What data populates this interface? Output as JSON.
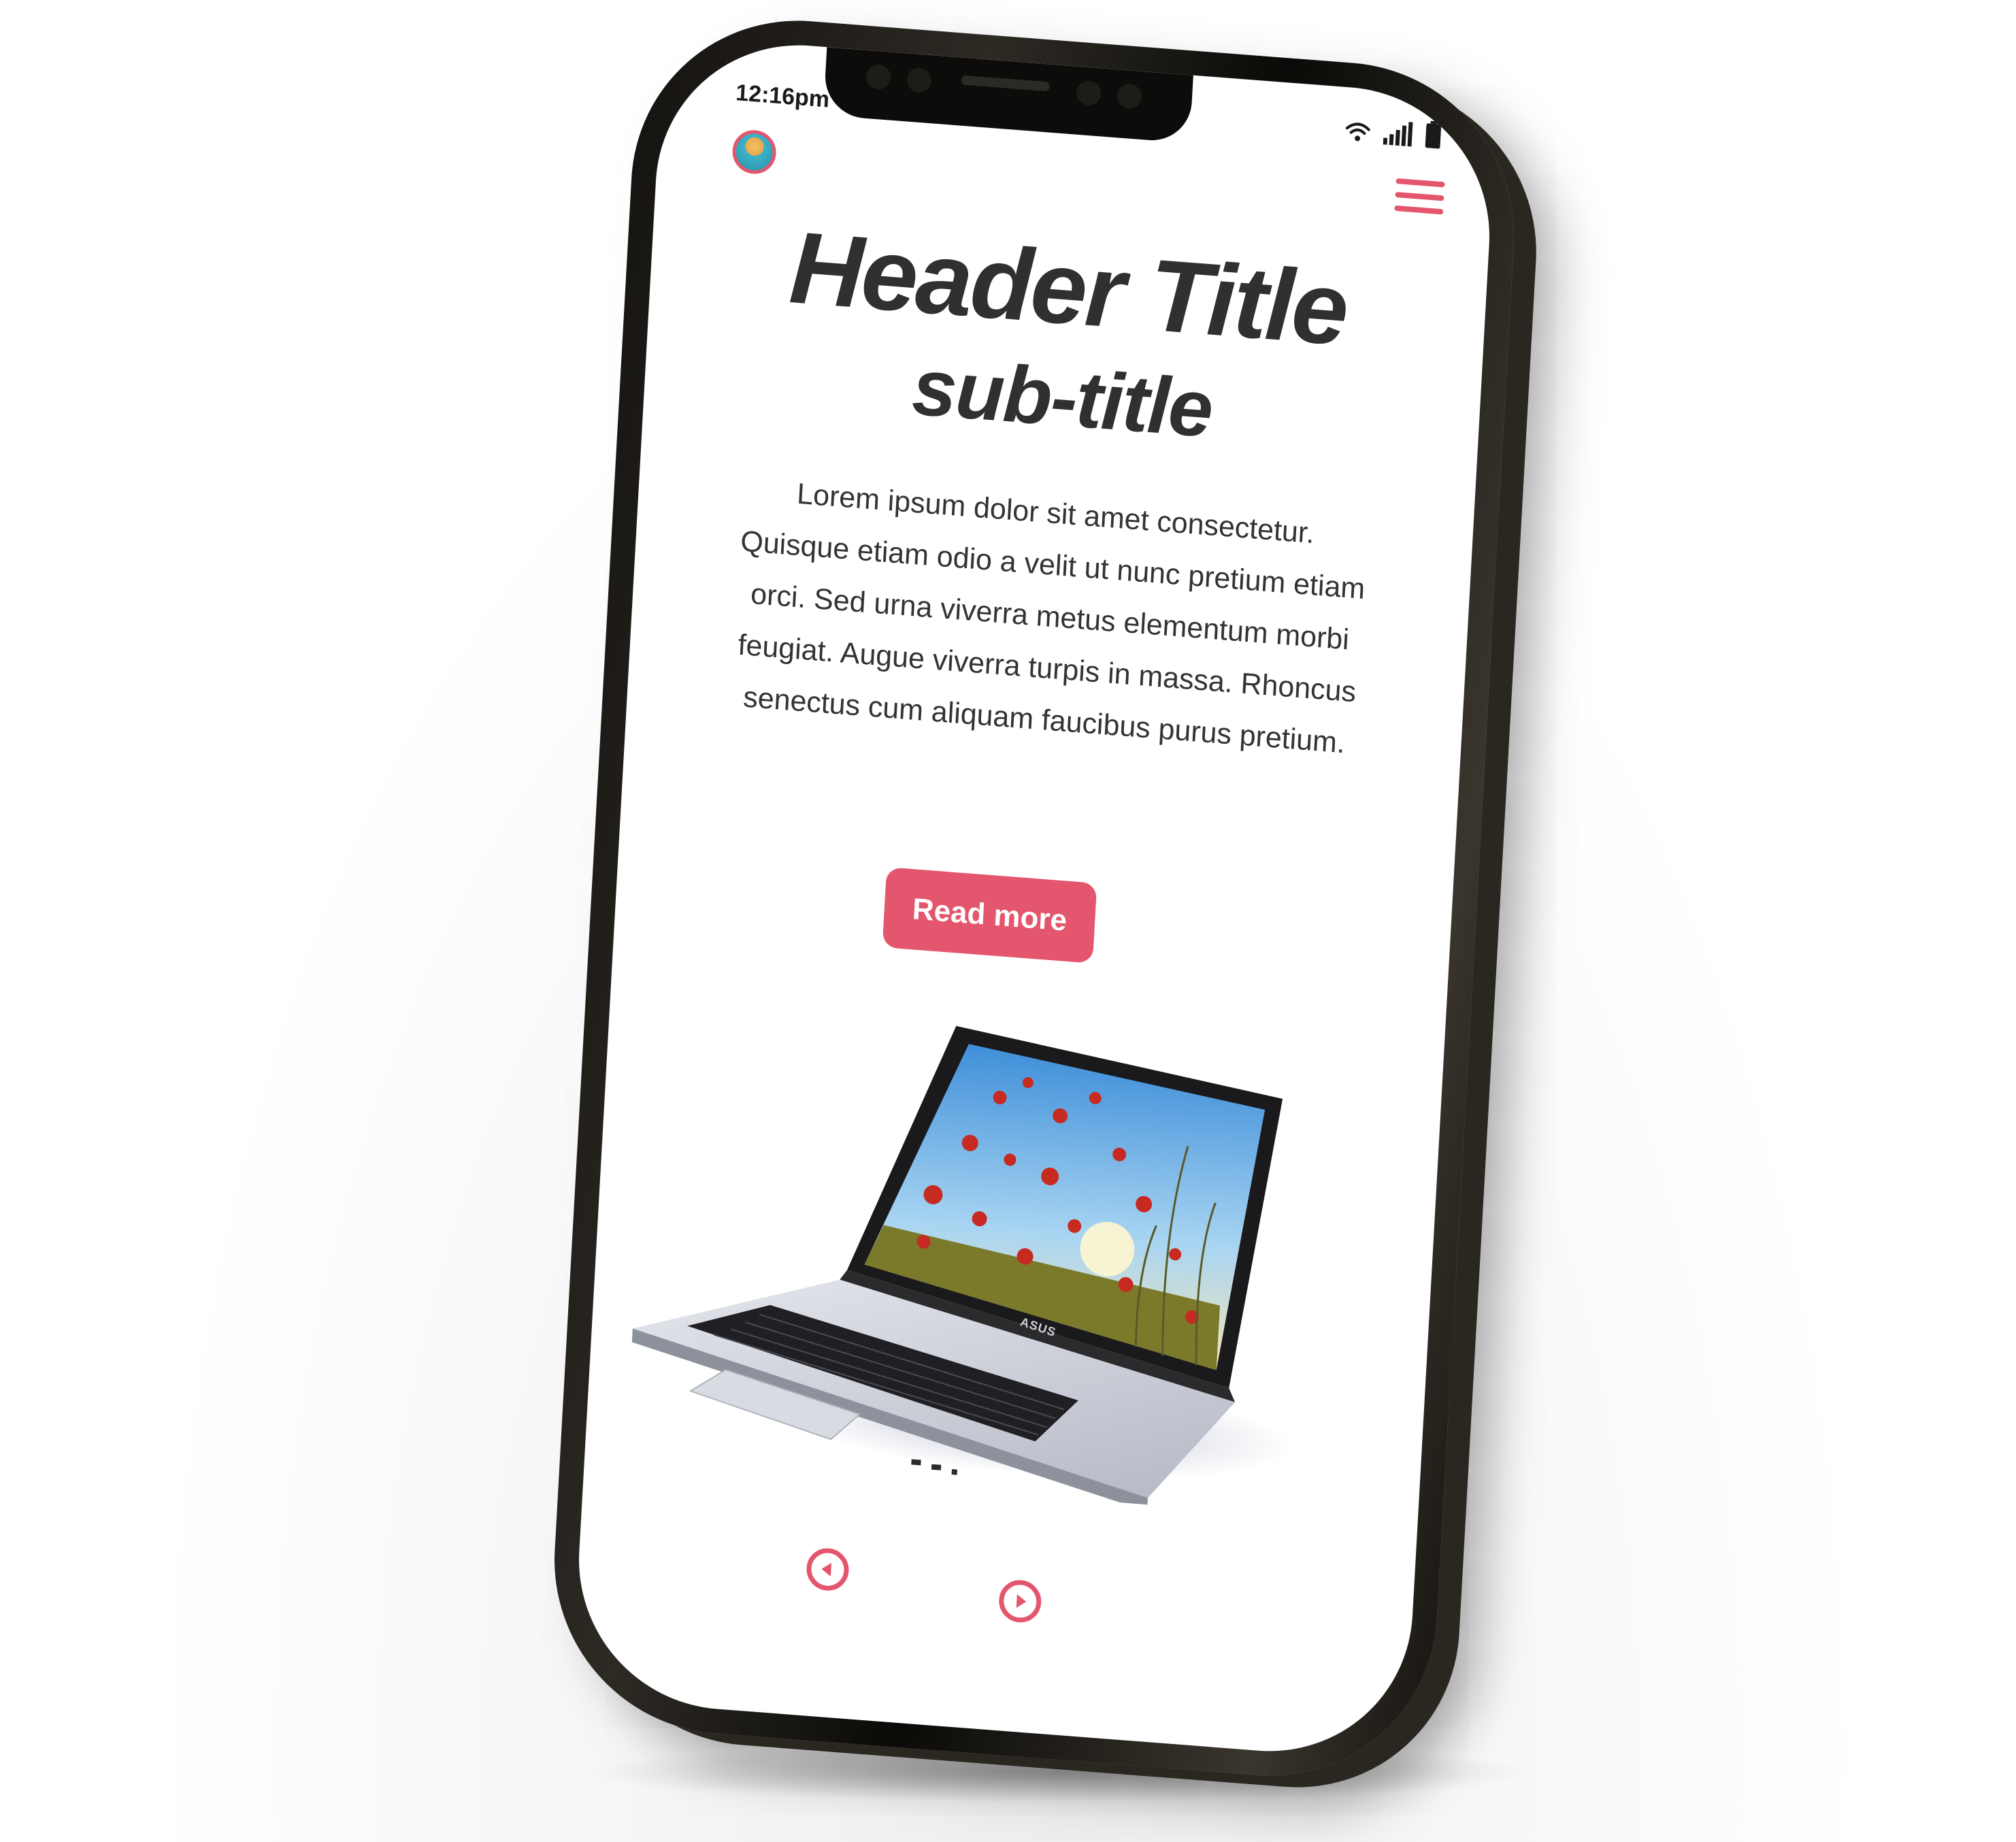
{
  "status_bar": {
    "time": "12:16pm",
    "wifi_icon": "wifi-icon",
    "signal_icon": "signal-icon",
    "battery_icon": "battery-icon"
  },
  "header": {
    "avatar_icon": "avatar",
    "menu_icon": "hamburger-menu-icon"
  },
  "hero": {
    "title": "Header Title",
    "subtitle": "sub-title",
    "body": "Lorem ipsum dolor sit amet consectetur. Quisque etiam odio a velit ut nunc pretium etiam orci. Sed urna viverra metus elementum morbi feugiat. Augue viverra turpis in massa. Rhoncus senectus cum aliquam faucibus purus pretium.",
    "cta_label": "Read more",
    "image_label": "laptop-image",
    "laptop_logo": "ASUS"
  },
  "pager": {
    "prev_icon": "arrow-left-circle-icon",
    "next_icon": "arrow-right-circle-icon"
  },
  "colors": {
    "accent": "#e3566d",
    "text": "#303030",
    "background": "#ffffff",
    "device_frame": "#1c1a16"
  }
}
